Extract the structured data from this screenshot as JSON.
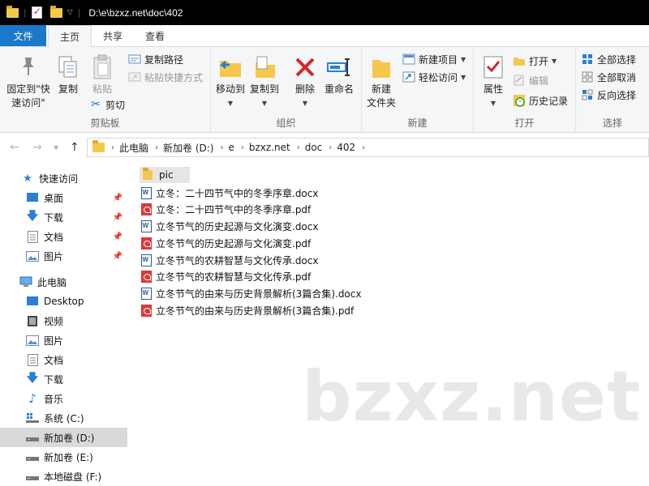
{
  "titlebar": {
    "path": "D:\\e\\bzxz.net\\doc\\402",
    "quick_access": [
      "folder-icon",
      "properties-icon",
      "new-folder-icon"
    ]
  },
  "ribbon_tabs": [
    "文件",
    "主页",
    "共享",
    "查看"
  ],
  "ribbon": {
    "clipboard": {
      "label": "剪贴板",
      "pin": "固定到\"快\n速访问\"",
      "copy": "复制",
      "paste": "粘贴",
      "copy_path": "复制路径",
      "paste_shortcut": "粘贴快捷方式",
      "cut": "剪切"
    },
    "organize": {
      "label": "组织",
      "move_to": "移动到",
      "copy_to": "复制到",
      "delete": "删除",
      "rename": "重命名"
    },
    "new": {
      "label": "新建",
      "new_folder": "新建\n文件夹",
      "new_item": "新建项目",
      "easy_access": "轻松访问"
    },
    "open": {
      "label": "打开",
      "properties": "属性",
      "open": "打开",
      "edit": "编辑",
      "history": "历史记录"
    },
    "select": {
      "label": "选择",
      "select_all": "全部选择",
      "select_none": "全部取消",
      "invert": "反向选择"
    }
  },
  "address": {
    "crumbs": [
      "此电脑",
      "新加卷 (D:)",
      "e",
      "bzxz.net",
      "doc",
      "402"
    ]
  },
  "nav": {
    "quick_access": "快速访问",
    "qa_items": [
      "桌面",
      "下载",
      "文档",
      "图片"
    ],
    "this_pc": "此电脑",
    "pc_items": [
      "Desktop",
      "视频",
      "图片",
      "文档",
      "下载",
      "音乐",
      "系统 (C:)",
      "新加卷 (D:)",
      "新加卷 (E:)",
      "本地磁盘 (F:)"
    ]
  },
  "files": [
    {
      "name": "pic",
      "type": "folder"
    },
    {
      "name": "立冬：二十四节气中的冬季序章.docx",
      "type": "docx"
    },
    {
      "name": "立冬：二十四节气中的冬季序章.pdf",
      "type": "pdf"
    },
    {
      "name": "立冬节气的历史起源与文化演变.docx",
      "type": "docx"
    },
    {
      "name": "立冬节气的历史起源与文化演变.pdf",
      "type": "pdf"
    },
    {
      "name": "立冬节气的农耕智慧与文化传承.docx",
      "type": "docx"
    },
    {
      "name": "立冬节气的农耕智慧与文化传承.pdf",
      "type": "pdf"
    },
    {
      "name": "立冬节气的由来与历史背景解析(3篇合集).docx",
      "type": "docx"
    },
    {
      "name": "立冬节气的由来与历史背景解析(3篇合集).pdf",
      "type": "pdf"
    }
  ],
  "watermark": "bzxz.net",
  "colors": {
    "file_tab": "#1979ca",
    "folder": "#f5c84c",
    "pdf": "#d93a3a",
    "docx": "#2b579a",
    "delete_x": "#d22a2a"
  }
}
